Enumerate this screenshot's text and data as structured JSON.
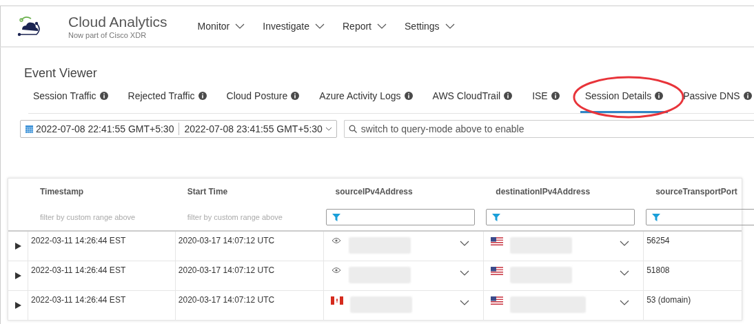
{
  "header": {
    "title": "Cloud Analytics",
    "subtitle": "Now part of Cisco XDR",
    "menu": [
      "Monitor",
      "Investigate",
      "Report",
      "Settings"
    ]
  },
  "page_title": "Event Viewer",
  "tabs": [
    {
      "label": "Session Traffic",
      "selected": false
    },
    {
      "label": "Rejected Traffic",
      "selected": false
    },
    {
      "label": "Cloud Posture",
      "selected": false
    },
    {
      "label": "Azure Activity Logs",
      "selected": false
    },
    {
      "label": "AWS CloudTrail",
      "selected": false
    },
    {
      "label": "ISE",
      "selected": false
    },
    {
      "label": "Session Details",
      "selected": true,
      "highlighted": true
    },
    {
      "label": "Passive DNS",
      "selected": false
    }
  ],
  "date_range": {
    "start": "2022-07-08 22:41:55 GMT+5:30",
    "end": "2022-07-08 23:41:55 GMT+5:30"
  },
  "search": {
    "placeholder": "switch to query-mode above to enable"
  },
  "table": {
    "columns": [
      {
        "label": "Timestamp",
        "filter": "filter by custom range above"
      },
      {
        "label": "Start Time",
        "filter": "filter by custom range above"
      },
      {
        "label": "sourceIPv4Address"
      },
      {
        "label": "destinationIPv4Address"
      },
      {
        "label": "sourceTransportPort"
      }
    ],
    "rows": [
      {
        "timestamp": "2022-03-11 14:26:44 EST",
        "start": "2020-03-17 14:07:12 UTC",
        "source": {
          "kind": "private"
        },
        "dest": {
          "kind": "us"
        },
        "port": "56254"
      },
      {
        "timestamp": "2022-03-11 14:26:44 EST",
        "start": "2020-03-17 14:07:12 UTC",
        "source": {
          "kind": "private"
        },
        "dest": {
          "kind": "us"
        },
        "port": "51808"
      },
      {
        "timestamp": "2022-03-11 14:26:44 EST",
        "start": "2020-03-17 14:07:12 UTC",
        "source": {
          "kind": "ca"
        },
        "dest": {
          "kind": "us"
        },
        "port": "53 (domain)"
      }
    ]
  }
}
